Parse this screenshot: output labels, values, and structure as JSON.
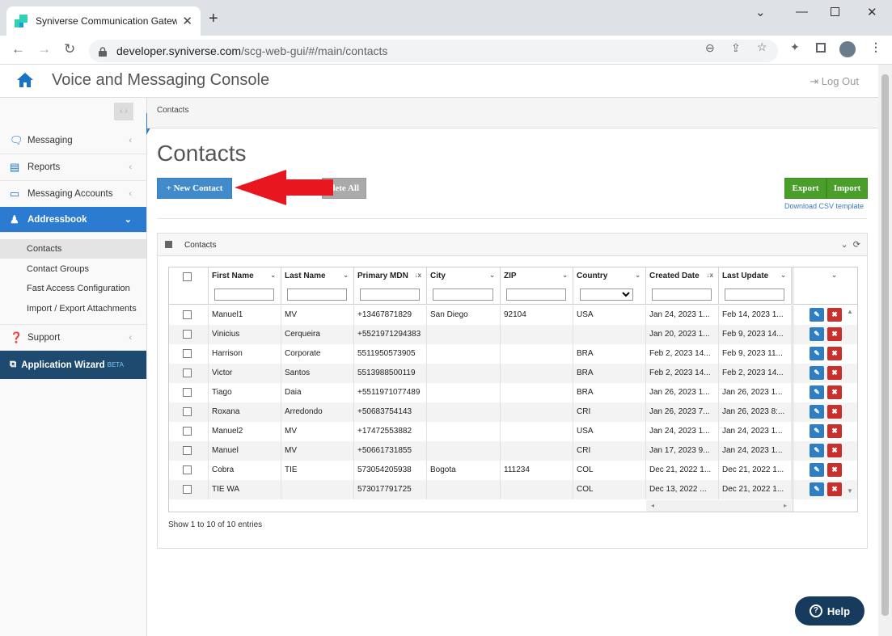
{
  "browser": {
    "tab_title": "Syniverse Communication Gatew",
    "url_host": "developer.syniverse.com",
    "url_path": "/scg-web-gui/#/main/contacts"
  },
  "app": {
    "title": "Voice and Messaging Console",
    "logout_label": "Log Out"
  },
  "sidebar": {
    "items": [
      {
        "label": "Messaging",
        "icon": "chat-icon"
      },
      {
        "label": "Reports",
        "icon": "list-icon"
      },
      {
        "label": "Messaging Accounts",
        "icon": "monitor-icon"
      },
      {
        "label": "Addressbook",
        "icon": "user-icon"
      }
    ],
    "sub_items": [
      {
        "label": "Contacts"
      },
      {
        "label": "Contact Groups"
      },
      {
        "label": "Fast Access Configuration"
      },
      {
        "label": "Import / Export Attachments"
      }
    ],
    "support_label": "Support",
    "wizard_label": "Application Wizard",
    "wizard_badge": "BETA"
  },
  "breadcrumb": "Contacts",
  "page": {
    "title": "Contacts",
    "new_contact_label": "+ New Contact",
    "delete_all_label": "lete All",
    "export_label": "Export",
    "import_label": "Import",
    "csv_link": "Download CSV template"
  },
  "widget": {
    "title": "Contacts",
    "entries_text": "Show 1 to 10 of 10 entries"
  },
  "table": {
    "columns": [
      "First Name",
      "Last Name",
      "Primary MDN",
      "City",
      "ZIP",
      "Country",
      "Created Date",
      "Last Update"
    ],
    "rows": [
      [
        "Manuel1",
        "MV",
        "+13467871829",
        "San Diego",
        "92104",
        "USA",
        "Jan 24, 2023 1...",
        "Feb 14, 2023 1..."
      ],
      [
        "Vinicius",
        "Cerqueira",
        "+5521971294383",
        "",
        "",
        "",
        "Jan 20, 2023 1...",
        "Feb 9, 2023 14..."
      ],
      [
        "Harrison",
        "Corporate",
        "5511950573905",
        "",
        "",
        "BRA",
        "Feb 2, 2023 14...",
        "Feb 9, 2023 11..."
      ],
      [
        "Victor",
        "Santos",
        "5513988500119",
        "",
        "",
        "BRA",
        "Feb 2, 2023 14...",
        "Feb 2, 2023 14..."
      ],
      [
        "Tiago",
        "Daia",
        "+5511971077489",
        "",
        "",
        "BRA",
        "Jan 26, 2023 1...",
        "Jan 26, 2023 1..."
      ],
      [
        "Roxana",
        "Arredondo",
        "+50683754143",
        "",
        "",
        "CRI",
        "Jan 26, 2023 7...",
        "Jan 26, 2023 8:..."
      ],
      [
        "Manuel2",
        "MV",
        "+17472553882",
        "",
        "",
        "USA",
        "Jan 24, 2023 1...",
        "Jan 24, 2023 1..."
      ],
      [
        "Manuel",
        "MV",
        "+50661731855",
        "",
        "",
        "CRI",
        "Jan 17, 2023 9...",
        "Jan 24, 2023 1..."
      ],
      [
        "Cobra",
        "TIE",
        "573054205938",
        "Bogota",
        "111234",
        "COL",
        "Dec 21, 2022 1...",
        "Dec 21, 2022 1..."
      ],
      [
        "TIE WA",
        "",
        "573017791725",
        "",
        "",
        "COL",
        "Dec 13, 2022 ...",
        "Dec 21, 2022 1..."
      ]
    ]
  },
  "help_label": "Help"
}
